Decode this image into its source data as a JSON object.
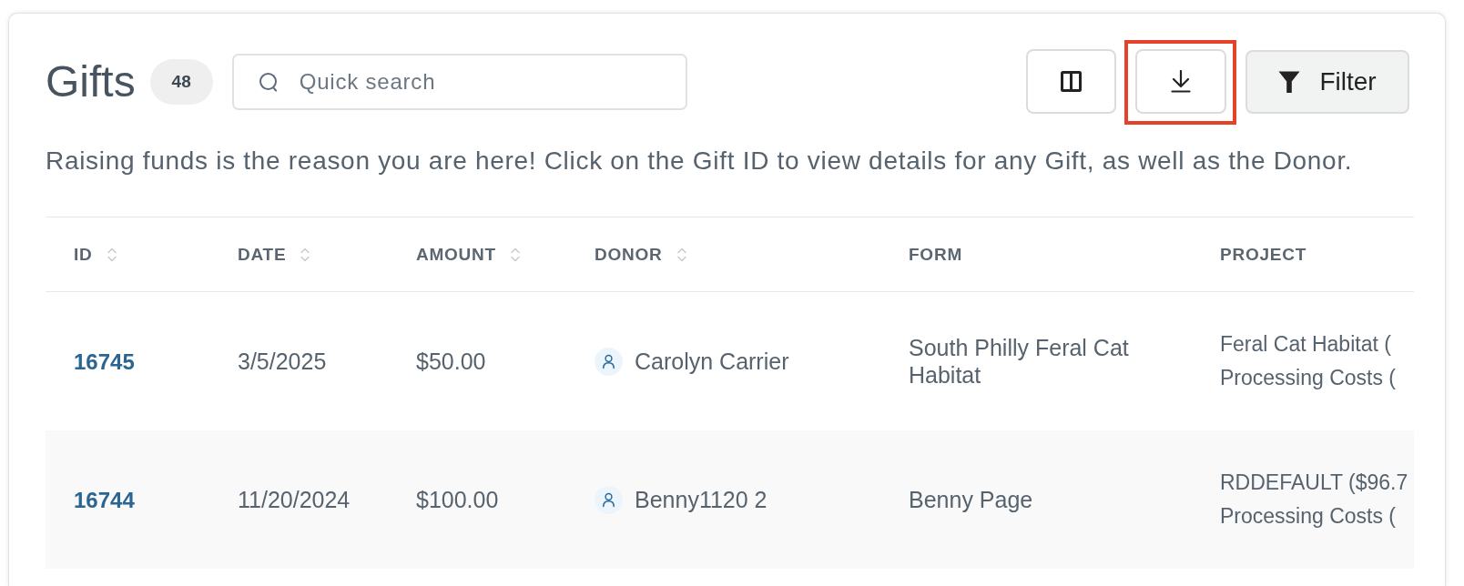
{
  "header": {
    "title": "Gifts",
    "count": "48",
    "search": {
      "placeholder": "Quick search"
    },
    "toolbar": [
      {
        "kind": "columns",
        "highlighted": false
      },
      {
        "kind": "download",
        "highlighted": true
      },
      {
        "kind": "filter",
        "label": "Filter",
        "highlighted": false
      }
    ]
  },
  "description": "Raising funds is the reason you are here! Click on the Gift ID to view details for any Gift, as well as the Donor.",
  "table": {
    "columns": [
      {
        "label": "ID",
        "sortable": true
      },
      {
        "label": "DATE",
        "sortable": true
      },
      {
        "label": "AMOUNT",
        "sortable": true
      },
      {
        "label": "DONOR",
        "sortable": true
      },
      {
        "label": "FORM",
        "sortable": false
      },
      {
        "label": "PROJECT",
        "sortable": false
      }
    ],
    "rows": [
      {
        "id": "16745",
        "date": "3/5/2025",
        "amount": "$50.00",
        "donor": "Carolyn Carrier",
        "form": "South Philly Feral Cat Habitat",
        "project": [
          "Feral Cat Habitat (",
          "Processing Costs ("
        ]
      },
      {
        "id": "16744",
        "date": "11/20/2024",
        "amount": "$100.00",
        "donor": "Benny1120 2",
        "form": "Benny Page",
        "project": [
          "RDDEFAULT ($96.7",
          "Processing Costs ("
        ]
      }
    ]
  }
}
